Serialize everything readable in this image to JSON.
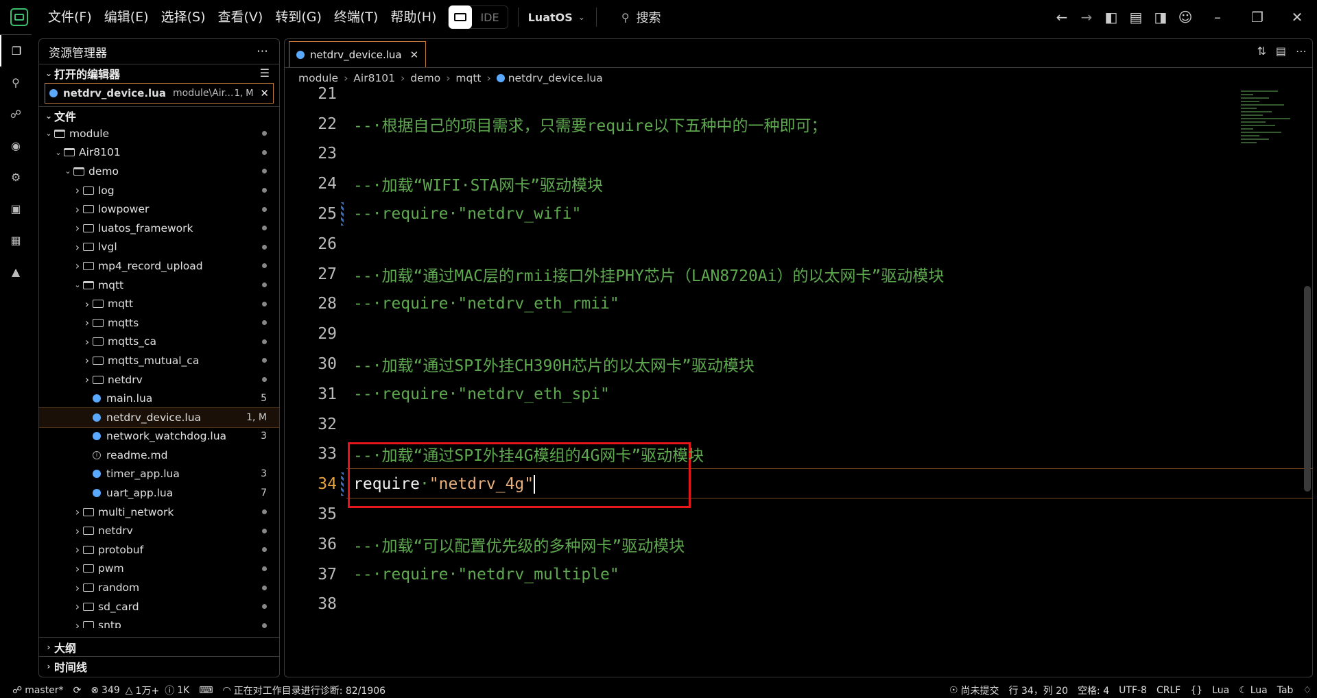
{
  "menu": [
    "文件(F)",
    "编辑(E)",
    "选择(S)",
    "查看(V)",
    "转到(G)",
    "终端(T)",
    "帮助(H)"
  ],
  "ide_label": "IDE",
  "profile": "LuatOS",
  "search_label": "搜索",
  "sidebar": {
    "title": "资源管理器",
    "open_editors_title": "打开的编辑器",
    "open_editor": {
      "name": "netdrv_device.lua",
      "path": "module\\Air...",
      "badge": "1, M"
    },
    "files_title": "文件",
    "tree": [
      {
        "label": "module",
        "depth": 0,
        "type": "folder-open",
        "mark": "dot"
      },
      {
        "label": "Air8101",
        "depth": 1,
        "type": "folder-open",
        "mark": "dot"
      },
      {
        "label": "demo",
        "depth": 2,
        "type": "folder-open",
        "mark": "dot"
      },
      {
        "label": "log",
        "depth": 3,
        "type": "folder",
        "mark": "dot"
      },
      {
        "label": "lowpower",
        "depth": 3,
        "type": "folder",
        "mark": "dot"
      },
      {
        "label": "luatos_framework",
        "depth": 3,
        "type": "folder",
        "mark": "dot"
      },
      {
        "label": "lvgl",
        "depth": 3,
        "type": "folder",
        "mark": "dot"
      },
      {
        "label": "mp4_record_upload",
        "depth": 3,
        "type": "folder",
        "mark": "dot"
      },
      {
        "label": "mqtt",
        "depth": 3,
        "type": "folder-open",
        "mark": "dot"
      },
      {
        "label": "mqtt",
        "depth": 4,
        "type": "folder",
        "mark": "dot"
      },
      {
        "label": "mqtts",
        "depth": 4,
        "type": "folder",
        "mark": "dot"
      },
      {
        "label": "mqtts_ca",
        "depth": 4,
        "type": "folder",
        "mark": "dot"
      },
      {
        "label": "mqtts_mutual_ca",
        "depth": 4,
        "type": "folder",
        "mark": "dot"
      },
      {
        "label": "netdrv",
        "depth": 4,
        "type": "folder",
        "mark": "dot"
      },
      {
        "label": "main.lua",
        "depth": 4,
        "type": "lua",
        "mark": "5"
      },
      {
        "label": "netdrv_device.lua",
        "depth": 4,
        "type": "lua",
        "mark": "1, M",
        "selected": true
      },
      {
        "label": "network_watchdog.lua",
        "depth": 4,
        "type": "lua",
        "mark": "3"
      },
      {
        "label": "readme.md",
        "depth": 4,
        "type": "info",
        "mark": ""
      },
      {
        "label": "timer_app.lua",
        "depth": 4,
        "type": "lua",
        "mark": "3"
      },
      {
        "label": "uart_app.lua",
        "depth": 4,
        "type": "lua",
        "mark": "7"
      },
      {
        "label": "multi_network",
        "depth": 3,
        "type": "folder",
        "mark": "dot"
      },
      {
        "label": "netdrv",
        "depth": 3,
        "type": "folder",
        "mark": "dot"
      },
      {
        "label": "protobuf",
        "depth": 3,
        "type": "folder",
        "mark": "dot"
      },
      {
        "label": "pwm",
        "depth": 3,
        "type": "folder",
        "mark": "dot"
      },
      {
        "label": "random",
        "depth": 3,
        "type": "folder",
        "mark": "dot"
      },
      {
        "label": "sd_card",
        "depth": 3,
        "type": "folder",
        "mark": "dot"
      },
      {
        "label": "sntp",
        "depth": 3,
        "type": "folder",
        "mark": "dot"
      }
    ],
    "outline_title": "大纲",
    "timeline_title": "时间线"
  },
  "editor": {
    "tab": "netdrv_device.lua",
    "breadcrumb": [
      "module",
      "Air8101",
      "demo",
      "mqtt",
      "netdrv_device.lua"
    ],
    "lines": [
      {
        "n": "21",
        "parts": []
      },
      {
        "n": "22",
        "parts": [
          {
            "c": "cm",
            "t": "--·根据自己的项目需求，只需要require以下五种中的一种即可；"
          }
        ]
      },
      {
        "n": "23",
        "parts": []
      },
      {
        "n": "24",
        "parts": [
          {
            "c": "cm",
            "t": "--·加载“WIFI·STA网卡”驱动模块"
          }
        ]
      },
      {
        "n": "25",
        "parts": [
          {
            "c": "cm",
            "t": "--·require·\"netdrv_wifi\""
          }
        ],
        "mod": true
      },
      {
        "n": "26",
        "parts": []
      },
      {
        "n": "27",
        "parts": [
          {
            "c": "cm",
            "t": "--·加载“通过MAC层的rmii接口外挂PHY芯片（LAN8720Ai）的以太网卡”驱动模块"
          }
        ]
      },
      {
        "n": "28",
        "parts": [
          {
            "c": "cm",
            "t": "--·require·\"netdrv_eth_rmii\""
          }
        ]
      },
      {
        "n": "29",
        "parts": []
      },
      {
        "n": "30",
        "parts": [
          {
            "c": "cm",
            "t": "--·加载“通过SPI外挂CH390H芯片的以太网卡”驱动模块"
          }
        ]
      },
      {
        "n": "31",
        "parts": [
          {
            "c": "cm",
            "t": "--·require·\"netdrv_eth_spi\""
          }
        ]
      },
      {
        "n": "32",
        "parts": []
      },
      {
        "n": "33",
        "parts": [
          {
            "c": "cm",
            "t": "--·加载“通过SPI外挂4G模组的4G网卡”驱动模块"
          }
        ]
      },
      {
        "n": "34",
        "parts": [
          {
            "c": "kw",
            "t": "require"
          },
          {
            "c": "cm",
            "t": "·"
          },
          {
            "c": "str",
            "t": "\"netdrv_4g\""
          }
        ],
        "mod": true,
        "current": true
      },
      {
        "n": "35",
        "parts": []
      },
      {
        "n": "36",
        "parts": [
          {
            "c": "cm",
            "t": "--·加载“可以配置优先级的多种网卡”驱动模块"
          }
        ]
      },
      {
        "n": "37",
        "parts": [
          {
            "c": "cm",
            "t": "--·require·\"netdrv_multiple\""
          }
        ]
      },
      {
        "n": "38",
        "parts": []
      }
    ]
  },
  "status": {
    "branch": "master*",
    "errors": "349",
    "warnings": "1万+",
    "infos": "1K",
    "diagnostics": "正在对工作目录进行诊断: 82/1906",
    "commit": "尚未提交",
    "position": "行 34，列 20",
    "spaces": "空格: 4",
    "encoding": "UTF-8",
    "eol": "CRLF",
    "braces": "{}",
    "lang": "Lua",
    "lang2": "Lua",
    "tab": "Tab"
  }
}
